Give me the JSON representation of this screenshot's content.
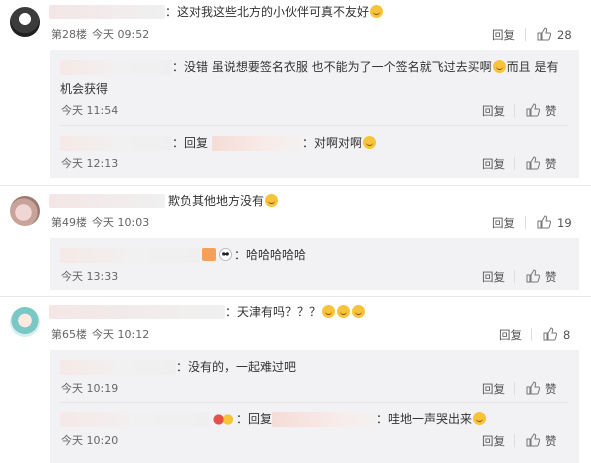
{
  "comments": [
    {
      "text": "：这对我这些北方的小伙伴可真不友好",
      "floor": "第28楼",
      "time": "今天 09:52",
      "reply_label": "回复",
      "likes": "28"
    },
    {
      "text": "欺负其他地方没有",
      "floor": "第49楼",
      "time": "今天 10:03",
      "reply_label": "回复",
      "likes": "19"
    },
    {
      "text": "：天津有吗？？？",
      "floor": "第65楼",
      "time": "今天 10:12",
      "reply_label": "回复",
      "likes": "8"
    }
  ],
  "replies": [
    {
      "line1": "：没错 虽说想要签名衣服 也不能为了一个签名就飞过去买啊",
      "line1_tail": "而且 是有",
      "line2": "机会获得",
      "time": "今天 11:54",
      "reply_label": "回复",
      "like_label": "赞"
    },
    {
      "prefix": "：回复",
      "text": "：对啊对啊",
      "time": "今天 12:13",
      "reply_label": "回复",
      "like_label": "赞"
    },
    {
      "text": "：哈哈哈哈哈",
      "time": "今天 13:33",
      "reply_label": "回复",
      "like_label": "赞"
    },
    {
      "text": "：没有的，一起难过吧",
      "time": "今天 10:19",
      "reply_label": "回复",
      "like_label": "赞"
    },
    {
      "prefix": "：回复",
      "text": "：哇地一声哭出来",
      "time": "今天 10:20",
      "reply_label": "回复",
      "like_label": "赞"
    }
  ],
  "icons": {
    "like": "thumbs-up-icon",
    "emoji_laugh": "laugh-cry-emoji",
    "emoji_cry": "crying-emoji"
  },
  "colors": {
    "reply_bg": "#f2f2f5",
    "emoji": "#f6c33b"
  }
}
